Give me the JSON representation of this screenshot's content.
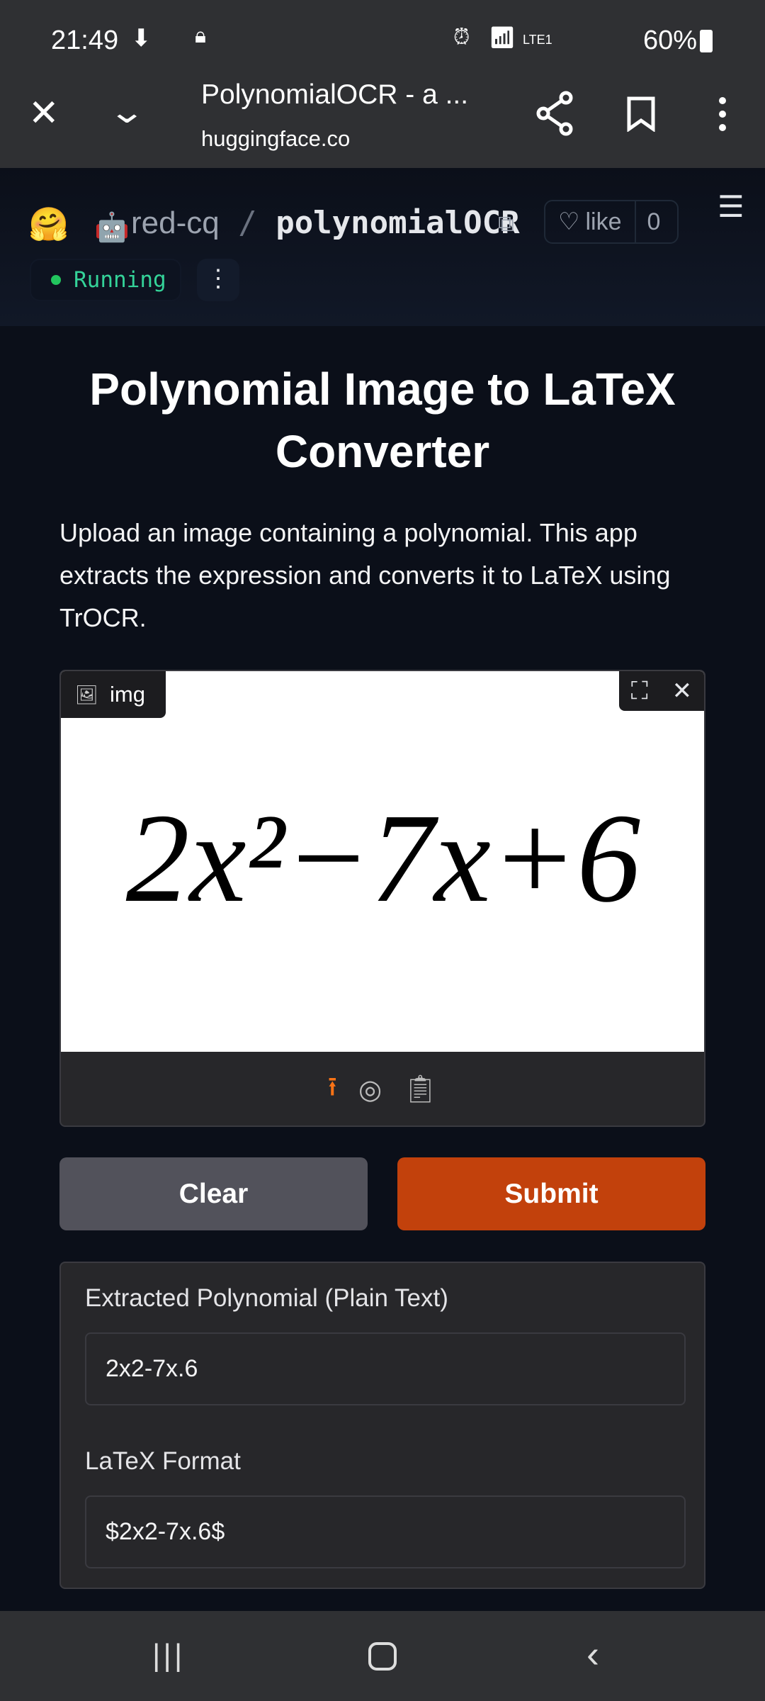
{
  "status_bar": {
    "time": "21:49",
    "battery": "60%",
    "network": "LTE1"
  },
  "browser": {
    "title": "PolynomialOCR - a ...",
    "url": "huggingface.co"
  },
  "space": {
    "owner": "red-cq",
    "name": "polynomialOCR",
    "like_label": "like",
    "like_count": "0",
    "status": "Running"
  },
  "app": {
    "title": "Polynomial Image to LaTeX Converter",
    "description": "Upload an image containing a polynomial. This app extracts the expression and converts it to LaTeX using TrOCR.",
    "image_label": "img",
    "image_expression": "2x²−7x+6",
    "clear_label": "Clear",
    "submit_label": "Submit",
    "outputs": [
      {
        "label": "Extracted Polynomial (Plain Text)",
        "value": "2x2-7x.6"
      },
      {
        "label": "LaTeX Format",
        "value": "$2x2-7x.6$"
      }
    ]
  },
  "colors": {
    "accent": "#c2410c",
    "running": "#22c55e",
    "upload_icon": "#f97316"
  }
}
